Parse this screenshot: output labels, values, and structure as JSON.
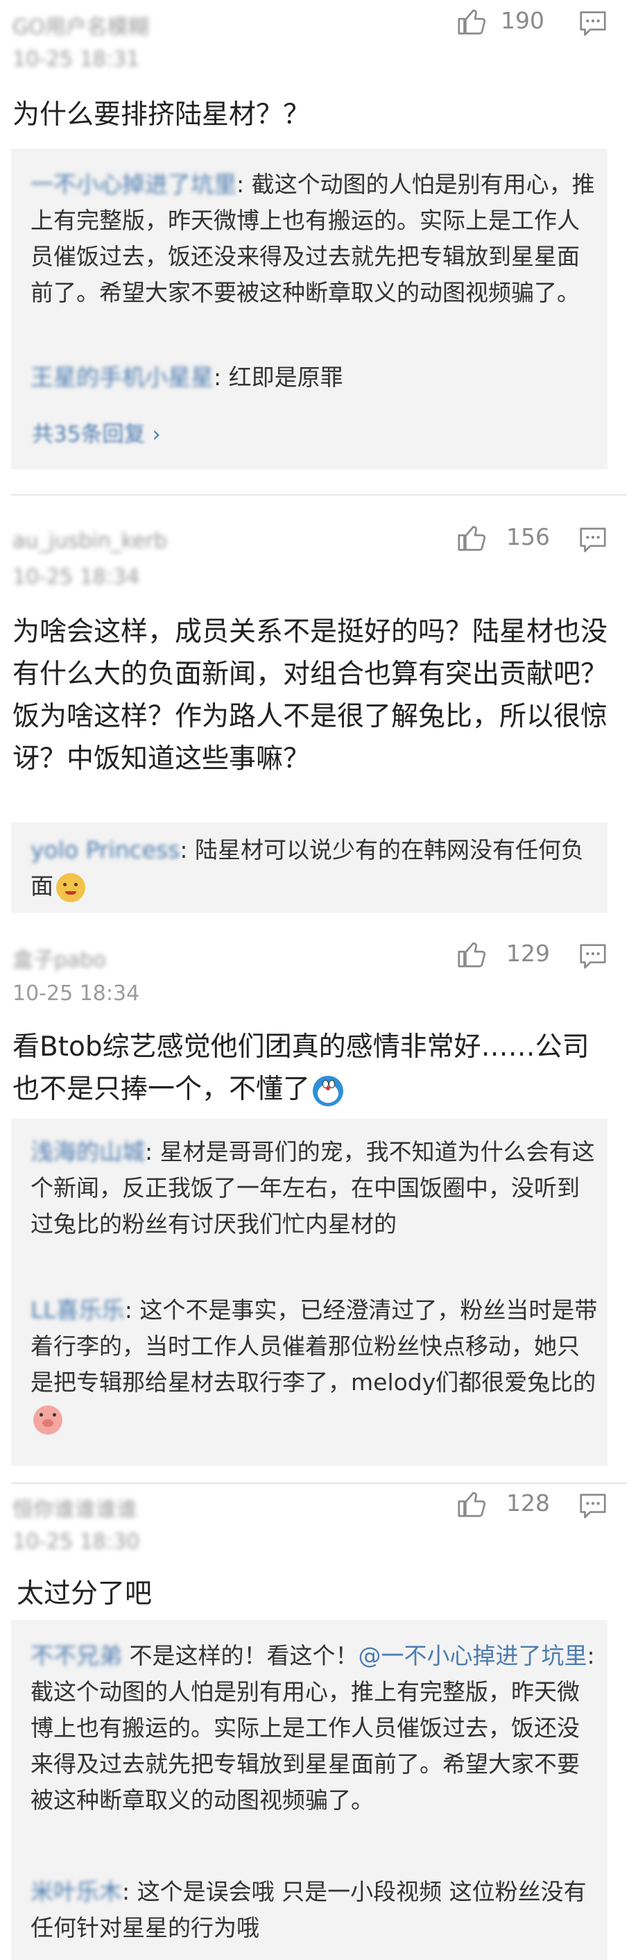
{
  "comments": [
    {
      "user": "GO用户名模糊",
      "time": "10-25 18:31",
      "likes": "190",
      "text": "为什么要排挤陆星材？？",
      "replies": [
        {
          "user": "一不小心掉进了坑里",
          "text": "截这个动图的人怕是别有用心，推上有完整版，昨天微博上也有搬运的。实际上是工作人员催饭过去，饭还没来得及过去就先把专辑放到星星面前了。希望大家不要被这种断章取义的动图视频骗了。"
        },
        {
          "user": "王星的手机小星星",
          "text": "红即是原罪"
        }
      ],
      "more_replies": "共35条回复",
      "more_arrow": "›"
    },
    {
      "user": "au_jusbin_kerb",
      "time": "10-25 18:34",
      "likes": "156",
      "text": "为啥会这样，成员关系不是挺好的吗？陆星材也没有什么大的负面新闻，对组合也算有突出贡献吧？饭为啥这样？作为路人不是很了解兔比，所以很惊讶？中饭知道这些事嘛？",
      "replies": [
        {
          "user": "yolo Princess",
          "text": "陆星材可以说少有的在韩网没有任何负面",
          "emoji": "shrug-emoji"
        }
      ]
    },
    {
      "user": "盒子pabo",
      "time": "10-25 18:34",
      "likes": "129",
      "text": "看Btob综艺感觉他们团真的感情非常好……公司也不是只捧一个，不懂了",
      "emoji": "doraemon-emoji",
      "replies": [
        {
          "user": "浅海的山城",
          "text": "星材是哥哥们的宠，我不知道为什么会有这个新闻，反正我饭了一年左右，在中国饭圈中，没听到过兔比的粉丝有讨厌我们忙内星材的"
        },
        {
          "user": "LL喜乐乐",
          "text": "这个不是事实，已经澄清过了，粉丝当时是带着行李的，当时工作人员催着那位粉丝快点移动，她只是把专辑那给星材去取行李了，melody们都很爱兔比的",
          "emoji": "pig-emoji"
        }
      ]
    },
    {
      "user": "恒你谁谁谁谁",
      "time": "10-25 18:30",
      "likes": "128",
      "text": "太过分了吧",
      "replies": [
        {
          "user": "不不兄弟",
          "pre": "不是这样的！看这个！",
          "mention": "@一不小心掉进了坑里",
          "text": "截这个动图的人怕是别有用心，推上有完整版，昨天微博上也有搬运的。实际上是工作人员催饭过去，饭还没来得及过去就先把专辑放到星星面前了。希望大家不要被这种断章取义的动图视频骗了。"
        },
        {
          "user": "米叶乐木",
          "text": "这个是误会哦 只是一小段视频 这位粉丝没有任何针对星星的行为哦"
        }
      ]
    }
  ]
}
